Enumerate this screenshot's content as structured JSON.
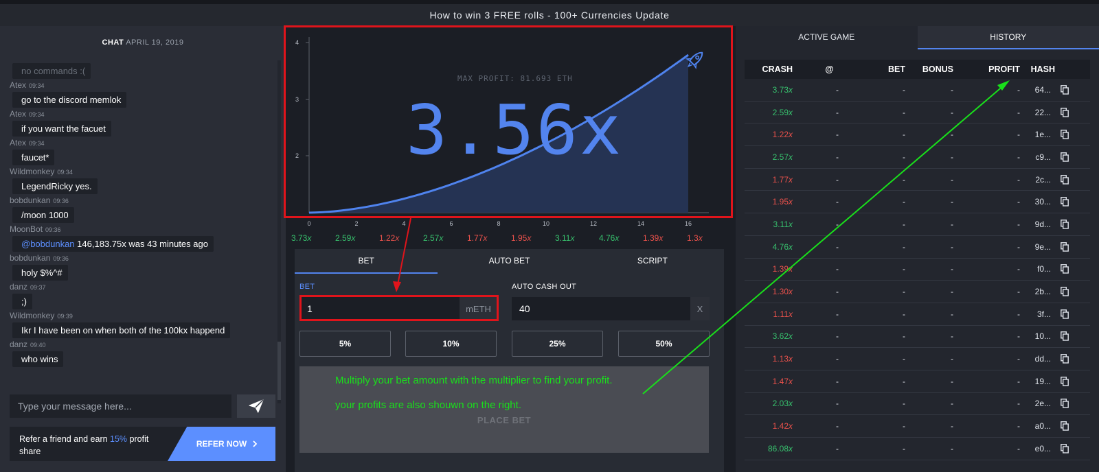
{
  "topbar": {
    "title": "How to win 3 FREE rolls - 100+ Currencies Update"
  },
  "chat": {
    "title": "CHAT",
    "date": "APRIL 19, 2019",
    "messages": [
      {
        "user": "",
        "time": "",
        "text": "no commands :("
      },
      {
        "user": "Atex",
        "time": "09:34",
        "text": "go to the discord memlok"
      },
      {
        "user": "Atex",
        "time": "09:34",
        "text": "if you want the facuet"
      },
      {
        "user": "Atex",
        "time": "09:34",
        "text": "faucet*"
      },
      {
        "user": "Wildmonkey",
        "time": "09:34",
        "text": "LegendRicky yes."
      },
      {
        "user": "bobdunkan",
        "time": "09:36",
        "text": "/moon 1000"
      },
      {
        "user": "MoonBot",
        "time": "09:36",
        "mention": "@bobdunkan",
        "text": " 146,183.75x was 43 minutes ago"
      },
      {
        "user": "bobdunkan",
        "time": "09:36",
        "text": "holy $%^#"
      },
      {
        "user": "danz",
        "time": "09:37",
        "text": ";)"
      },
      {
        "user": "Wildmonkey",
        "time": "09:39",
        "text": "Ikr I have been on when both of the 100kx happend"
      },
      {
        "user": "danz",
        "time": "09:40",
        "text": "who wins"
      }
    ],
    "input_placeholder": "Type your message here...",
    "refer_text_1": "Refer a friend and earn ",
    "refer_highlight": "15%",
    "refer_text_2": " profit share",
    "refer_button": "REFER NOW"
  },
  "graph": {
    "max_profit": "MAX PROFIT: 81.693 ETH",
    "multiplier": "3.56x",
    "x_ticks": [
      "0",
      "2",
      "4",
      "6",
      "8",
      "10",
      "12",
      "14",
      "16"
    ],
    "y_ticks": [
      "4",
      "3",
      "2"
    ],
    "colors": {
      "line": "#4f83ee",
      "fill": "#253353",
      "frame": "#e0141b"
    }
  },
  "recent_crashes": [
    {
      "v": "3.73",
      "c": "g"
    },
    {
      "v": "2.59",
      "c": "g"
    },
    {
      "v": "1.22",
      "c": "r"
    },
    {
      "v": "2.57",
      "c": "g"
    },
    {
      "v": "1.77",
      "c": "r"
    },
    {
      "v": "1.95",
      "c": "r"
    },
    {
      "v": "3.11",
      "c": "g"
    },
    {
      "v": "4.76",
      "c": "g"
    },
    {
      "v": "1.39",
      "c": "r"
    },
    {
      "v": "1.3",
      "c": "r"
    }
  ],
  "bet_tabs": [
    "BET",
    "AUTO BET",
    "SCRIPT"
  ],
  "bet_form": {
    "bet_label": "BET",
    "bet_value": "1",
    "bet_unit": "mETH",
    "auto_label": "AUTO CASH OUT",
    "auto_value": "40",
    "auto_unit": "X",
    "pct": [
      "5%",
      "10%",
      "25%",
      "50%"
    ],
    "place_bet": "PLACE BET"
  },
  "annotation": {
    "line1": "Multiply your bet amount with the multiplier to find your profit.",
    "line2": "your profits are also shouwn on the right."
  },
  "history": {
    "tabs": [
      "ACTIVE GAME",
      "HISTORY"
    ],
    "headers": [
      "CRASH",
      "@",
      "BET",
      "BONUS",
      "PROFIT",
      "HASH"
    ],
    "rows": [
      {
        "crash": "3.73",
        "c": "g",
        "hash": "64..."
      },
      {
        "crash": "2.59",
        "c": "g",
        "hash": "22..."
      },
      {
        "crash": "1.22",
        "c": "r",
        "hash": "1e..."
      },
      {
        "crash": "2.57",
        "c": "g",
        "hash": "c9..."
      },
      {
        "crash": "1.77",
        "c": "r",
        "hash": "2c..."
      },
      {
        "crash": "1.95",
        "c": "r",
        "hash": "30..."
      },
      {
        "crash": "3.11",
        "c": "g",
        "hash": "9d..."
      },
      {
        "crash": "4.76",
        "c": "g",
        "hash": "9e..."
      },
      {
        "crash": "1.39",
        "c": "r",
        "hash": "f0..."
      },
      {
        "crash": "1.30",
        "c": "r",
        "hash": "2b..."
      },
      {
        "crash": "1.11",
        "c": "r",
        "hash": "3f..."
      },
      {
        "crash": "3.62",
        "c": "g",
        "hash": "10..."
      },
      {
        "crash": "1.13",
        "c": "r",
        "hash": "dd..."
      },
      {
        "crash": "1.47",
        "c": "r",
        "hash": "19..."
      },
      {
        "crash": "2.03",
        "c": "g",
        "hash": "2e..."
      },
      {
        "crash": "1.42",
        "c": "r",
        "hash": "a0..."
      },
      {
        "crash": "86.08",
        "c": "g",
        "hash": "e0..."
      }
    ],
    "dash": "-",
    "suffix_x": "x"
  }
}
